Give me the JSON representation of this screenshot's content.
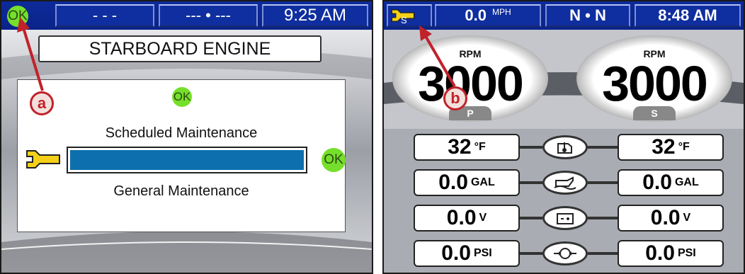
{
  "left_screen": {
    "status_ok": "OK",
    "segment_1": "- - -",
    "segment_2": "--- • ---",
    "time": "9:25 AM",
    "engine_label": "STARBOARD ENGINE",
    "card_ok": "OK",
    "scheduled_label": "Scheduled Maintenance",
    "general_label": "General Maintenance",
    "maintenance_ok": "OK",
    "maintenance_progress": 1.0,
    "callout": "a"
  },
  "right_screen": {
    "wrench_sub": "S",
    "speed": "0.0",
    "speed_unit": "MPH",
    "gear": "N • N",
    "time": "8:48 AM",
    "gauges": [
      {
        "caption": "RPM",
        "value": "3000",
        "tag": "P"
      },
      {
        "caption": "RPM",
        "value": "3000",
        "tag": "S"
      }
    ],
    "rows": [
      {
        "left_num": "32",
        "left_unit": "°F",
        "icon": "engine-temperature-icon",
        "right_num": "32",
        "right_unit": "°F"
      },
      {
        "left_num": "0.0",
        "left_unit": "GAL",
        "icon": "oil-can-icon",
        "right_num": "0.0",
        "right_unit": "GAL"
      },
      {
        "left_num": "0.0",
        "left_unit": "V",
        "icon": "battery-icon",
        "right_num": "0.0",
        "right_unit": "V"
      },
      {
        "left_num": "0.0",
        "left_unit": "PSI",
        "icon": "pressure-icon",
        "right_num": "0.0",
        "right_unit": "PSI"
      }
    ],
    "callout": "b"
  },
  "colors": {
    "bar_blue": "#0f2e9f",
    "ok_green": "#76df2b",
    "wrench_yellow": "#f4d018",
    "progress_blue": "#0d6fae",
    "callout_red": "#c0222a"
  }
}
